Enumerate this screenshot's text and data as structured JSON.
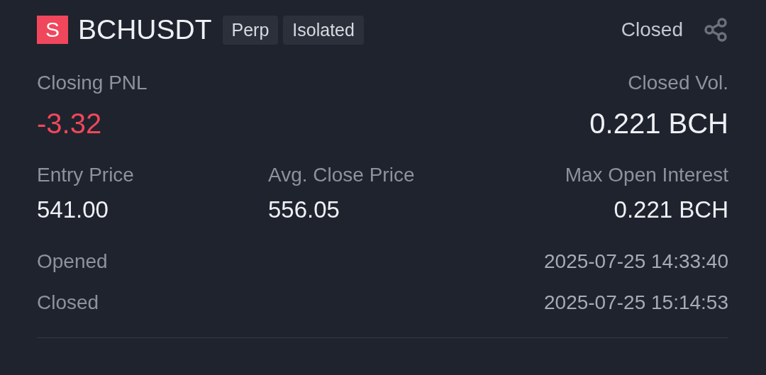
{
  "position": {
    "side_badge": "S",
    "symbol": "BCHUSDT",
    "tags": [
      "Perp",
      "Isolated"
    ],
    "status": "Closed"
  },
  "summary": [
    {
      "label": "Closing PNL",
      "value": "-3.32",
      "color": "#f0475c"
    },
    {
      "label": "Closed Vol.",
      "value": "0.221 BCH",
      "color": "#eef0f4"
    }
  ],
  "details": [
    {
      "label": "Entry Price",
      "value": "541.00"
    },
    {
      "label": "Avg. Close Price",
      "value": "556.05"
    },
    {
      "label": "Max Open Interest",
      "value": "0.221 BCH"
    }
  ],
  "times": [
    {
      "label": "Opened",
      "value": "2025-07-25 14:33:40"
    },
    {
      "label": "Closed",
      "value": "2025-07-25 15:14:53"
    }
  ]
}
